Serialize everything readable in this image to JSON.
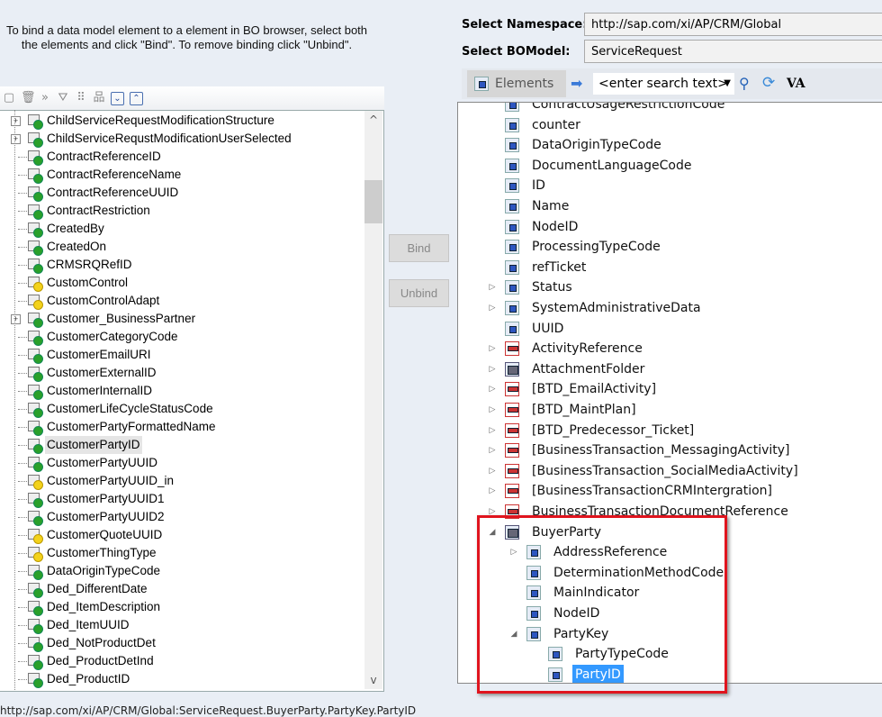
{
  "instructions": "To bind a data model element to a element in BO browser, select both the elements and click \"Bind\". To remove binding click \"Unbind\".",
  "left_toolbar": [
    "new-icon",
    "delete-icon",
    "forward-icon",
    "filter-icon",
    "hierarchy-icon",
    "tree-icon",
    "expand-all-icon",
    "collapse-all-icon"
  ],
  "left_tree": [
    {
      "label": "ChildServiceRequestModificationStructure",
      "icon": "structure",
      "expandable": true
    },
    {
      "label": "ChildServiceRequstModificationUserSelected",
      "icon": "structure",
      "expandable": true
    },
    {
      "label": "ContractReferenceID",
      "icon": "green"
    },
    {
      "label": "ContractReferenceName",
      "icon": "green"
    },
    {
      "label": "ContractReferenceUUID",
      "icon": "green"
    },
    {
      "label": "ContractRestriction",
      "icon": "green"
    },
    {
      "label": "CreatedBy",
      "icon": "green"
    },
    {
      "label": "CreatedOn",
      "icon": "green"
    },
    {
      "label": "CRMSRQRefID",
      "icon": "green"
    },
    {
      "label": "CustomControl",
      "icon": "yellow"
    },
    {
      "label": "CustomControlAdapt",
      "icon": "yellow"
    },
    {
      "label": "Customer_BusinessPartner",
      "icon": "structure",
      "expandable": true
    },
    {
      "label": "CustomerCategoryCode",
      "icon": "green"
    },
    {
      "label": "CustomerEmailURI",
      "icon": "green"
    },
    {
      "label": "CustomerExternalID",
      "icon": "green"
    },
    {
      "label": "CustomerInternalID",
      "icon": "green"
    },
    {
      "label": "CustomerLifeCycleStatusCode",
      "icon": "green"
    },
    {
      "label": "CustomerPartyFormattedName",
      "icon": "green"
    },
    {
      "label": "CustomerPartyID",
      "icon": "green",
      "selected": true
    },
    {
      "label": "CustomerPartyUUID",
      "icon": "green"
    },
    {
      "label": "CustomerPartyUUID_in",
      "icon": "yellow"
    },
    {
      "label": "CustomerPartyUUID1",
      "icon": "green"
    },
    {
      "label": "CustomerPartyUUID2",
      "icon": "green"
    },
    {
      "label": "CustomerQuoteUUID",
      "icon": "yellow"
    },
    {
      "label": "CustomerThingType",
      "icon": "yellow"
    },
    {
      "label": "DataOriginTypeCode",
      "icon": "green"
    },
    {
      "label": "Ded_DifferentDate",
      "icon": "green"
    },
    {
      "label": "Ded_ItemDescription",
      "icon": "green"
    },
    {
      "label": "Ded_ItemUUID",
      "icon": "green"
    },
    {
      "label": "Ded_NotProductDet",
      "icon": "green"
    },
    {
      "label": "Ded_ProductDetInd",
      "icon": "green"
    },
    {
      "label": "Ded_ProductID",
      "icon": "green"
    }
  ],
  "buttons": {
    "bind": "Bind",
    "unbind": "Unbind"
  },
  "namespace": {
    "label": "Select Namespace:",
    "value": "http://sap.com/xi/AP/CRM/Global"
  },
  "bomodel": {
    "label": "Select BOModel:",
    "value": "ServiceRequest"
  },
  "right_toolbar": {
    "elements": "Elements",
    "search_placeholder": "<enter search text>",
    "va": "VA"
  },
  "right_tree": [
    {
      "label": "ContractUsageRestrictionCode",
      "icon": "element",
      "level": 0
    },
    {
      "label": "counter",
      "icon": "element",
      "level": 0
    },
    {
      "label": "DataOriginTypeCode",
      "icon": "element",
      "level": 0
    },
    {
      "label": "DocumentLanguageCode",
      "icon": "element",
      "level": 0
    },
    {
      "label": "ID",
      "icon": "element",
      "level": 0
    },
    {
      "label": "Name",
      "icon": "element",
      "level": 0
    },
    {
      "label": "NodeID",
      "icon": "element",
      "level": 0
    },
    {
      "label": "ProcessingTypeCode",
      "icon": "element",
      "level": 0
    },
    {
      "label": "refTicket",
      "icon": "element",
      "level": 0
    },
    {
      "label": "Status",
      "icon": "element",
      "level": 0,
      "exp": "collapsed"
    },
    {
      "label": "SystemAdministrativeData",
      "icon": "element",
      "level": 0,
      "exp": "collapsed"
    },
    {
      "label": "UUID",
      "icon": "element",
      "level": 0
    },
    {
      "label": "ActivityReference",
      "icon": "assoc",
      "level": 0,
      "exp": "collapsed"
    },
    {
      "label": "AttachmentFolder",
      "icon": "folder",
      "level": 0,
      "exp": "collapsed"
    },
    {
      "label": "[BTD_EmailActivity]",
      "icon": "assoc",
      "level": 0,
      "exp": "collapsed"
    },
    {
      "label": "[BTD_MaintPlan]",
      "icon": "assoc",
      "level": 0,
      "exp": "collapsed"
    },
    {
      "label": "[BTD_Predecessor_Ticket]",
      "icon": "assoc",
      "level": 0,
      "exp": "collapsed"
    },
    {
      "label": "[BusinessTransaction_MessagingActivity]",
      "icon": "assoc",
      "level": 0,
      "exp": "collapsed"
    },
    {
      "label": "[BusinessTransaction_SocialMediaActivity]",
      "icon": "assoc",
      "level": 0,
      "exp": "collapsed"
    },
    {
      "label": "[BusinessTransactionCRMIntergration]",
      "icon": "assoc",
      "level": 0,
      "exp": "collapsed"
    },
    {
      "label": "BusinessTransactionDocumentReference",
      "icon": "assoc",
      "level": 0,
      "exp": "collapsed"
    },
    {
      "label": "BuyerParty",
      "icon": "folder",
      "level": 0,
      "exp": "expanded"
    },
    {
      "label": "AddressReference",
      "icon": "element",
      "level": 1,
      "exp": "collapsed"
    },
    {
      "label": "DeterminationMethodCode",
      "icon": "element",
      "level": 1
    },
    {
      "label": "MainIndicator",
      "icon": "element",
      "level": 1
    },
    {
      "label": "NodeID",
      "icon": "element",
      "level": 1
    },
    {
      "label": "PartyKey",
      "icon": "element",
      "level": 1,
      "exp": "expanded"
    },
    {
      "label": "PartyTypeCode",
      "icon": "element",
      "level": 2
    },
    {
      "label": "PartyID",
      "icon": "element",
      "level": 2,
      "selected": true
    }
  ],
  "status": "http://sap.com/xi/AP/CRM/Global:ServiceRequest.BuyerParty.PartyKey.PartyID"
}
